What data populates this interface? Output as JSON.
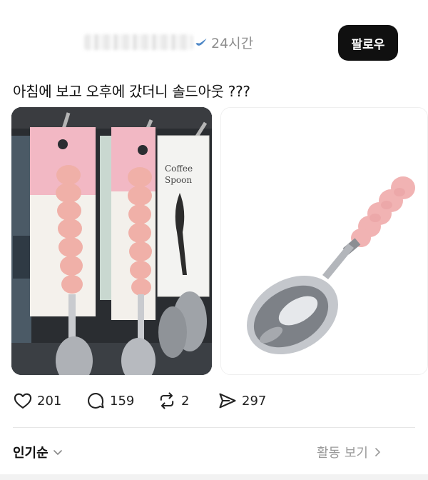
{
  "post": {
    "username_visible_fragments": "· ..l.. · . · ..ju",
    "time": "24시간",
    "follow_label": "팔로우",
    "text": "아침에 보고 오후에 갔더니 솔드아웃 ???",
    "images": [
      {
        "description_icon": "photo-store-spoons",
        "package_text": [
          "Coffee",
          "Spoon"
        ]
      },
      {
        "description_icon": "photo-spoon-product"
      }
    ],
    "counts": {
      "likes": "201",
      "replies": "159",
      "reposts": "2",
      "shares": "297"
    }
  },
  "comments": {
    "sort_label": "인기순",
    "activity_label": "활동 보기"
  },
  "colors": {
    "follow_bg": "#101010",
    "verified": "#4f88c7",
    "spoon_pink": "#f1b3b3"
  }
}
